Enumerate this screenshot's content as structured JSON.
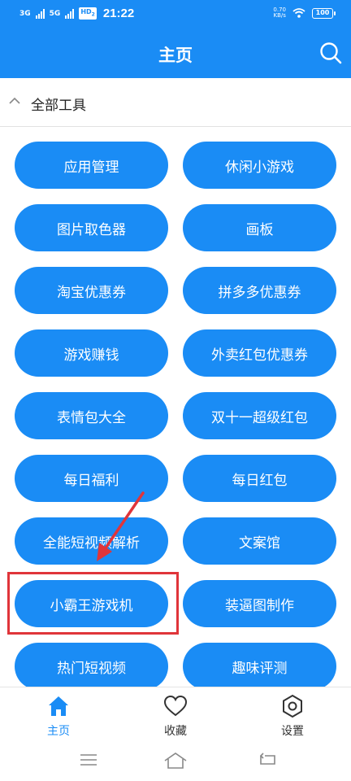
{
  "status_bar": {
    "signal1_label": "3G",
    "signal2_label": "5G",
    "hd_label": "HD",
    "hd_sub": "2",
    "time": "21:22",
    "speed_value": "0.70",
    "speed_unit": "KB/s",
    "battery": "100"
  },
  "header": {
    "title": "主页",
    "search_icon": "search-icon"
  },
  "section": {
    "title": "全部工具",
    "collapse_icon": "chevron-up-icon"
  },
  "tools": [
    {
      "label": "应用管理"
    },
    {
      "label": "休闲小游戏"
    },
    {
      "label": "图片取色器"
    },
    {
      "label": "画板"
    },
    {
      "label": "淘宝优惠券"
    },
    {
      "label": "拼多多优惠券"
    },
    {
      "label": "游戏赚钱"
    },
    {
      "label": "外卖红包优惠券"
    },
    {
      "label": "表情包大全"
    },
    {
      "label": "双十一超级红包"
    },
    {
      "label": "每日福利"
    },
    {
      "label": "每日红包"
    },
    {
      "label": "全能短视频解析"
    },
    {
      "label": "文案馆"
    },
    {
      "label": "小霸王游戏机"
    },
    {
      "label": "装逼图制作"
    },
    {
      "label": "热门短视频"
    },
    {
      "label": "趣味评测"
    }
  ],
  "annotation": {
    "highlight_color": "#e0353a"
  },
  "bottom_nav": [
    {
      "label": "主页",
      "icon": "home-icon",
      "active": true
    },
    {
      "label": "收藏",
      "icon": "heart-icon",
      "active": false
    },
    {
      "label": "设置",
      "icon": "settings-hexagon-icon",
      "active": false
    }
  ],
  "system_nav": {
    "menu_icon": "menu-icon",
    "home_icon": "home-outline-icon",
    "back_icon": "back-icon"
  },
  "colors": {
    "accent": "#1a8cf5",
    "text": "#222222",
    "divider": "#e2e2e2"
  }
}
